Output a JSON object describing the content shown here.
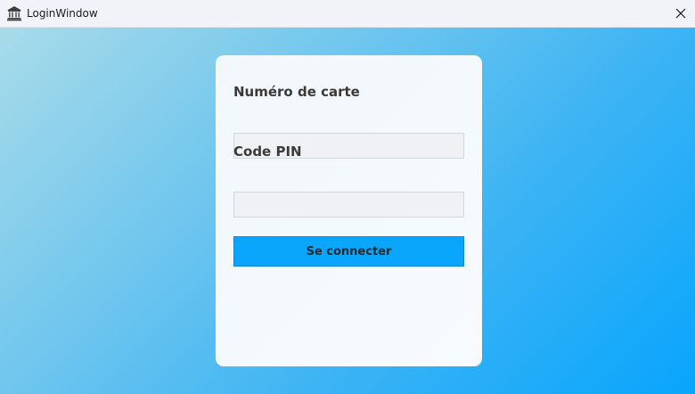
{
  "window": {
    "title": "LoginWindow",
    "app_icon": "bank-icon",
    "close_icon": "close-icon"
  },
  "form": {
    "card_number_label": "Numéro de carte",
    "card_number_value": "",
    "pin_label": "Code PIN",
    "pin_value": "",
    "submit_label": "Se connecter"
  },
  "colors": {
    "background_gradient_start": "#a8dbe9",
    "background_gradient_end": "#08a5fd",
    "card_background": "#f5f9fd",
    "button_background": "#0aa6fb",
    "input_background": "#eff1f4",
    "titlebar_background": "#f2f3f8"
  }
}
